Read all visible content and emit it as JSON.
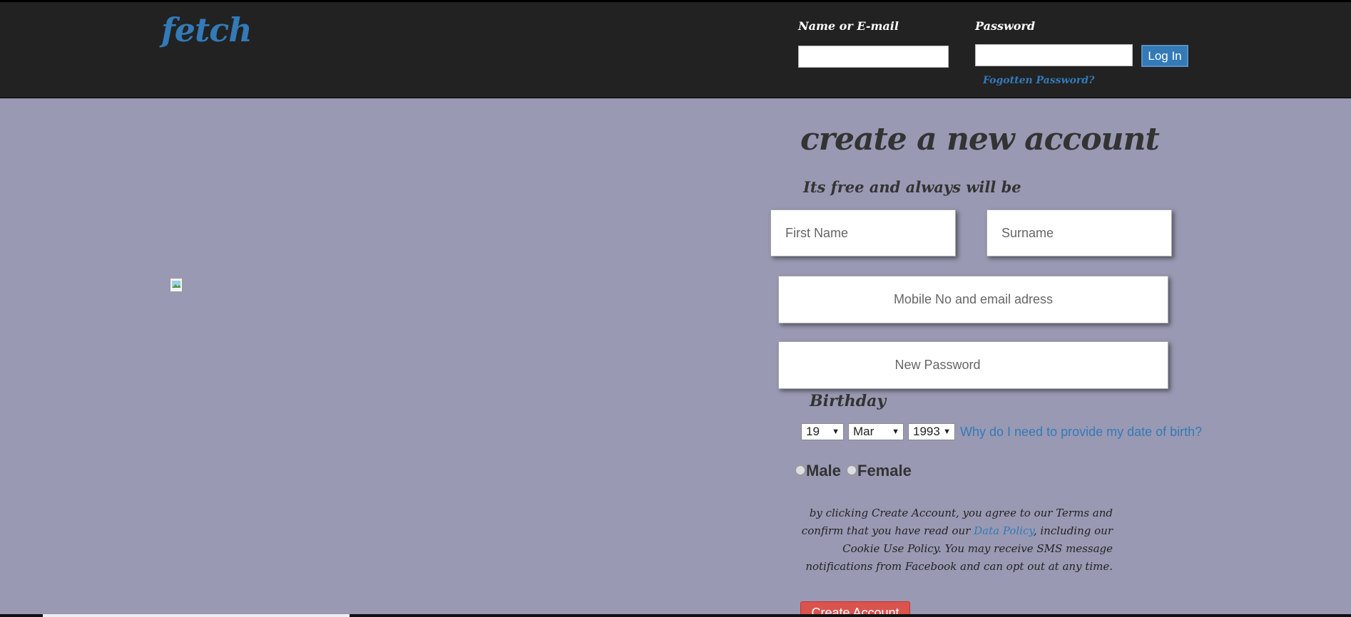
{
  "header": {
    "logo": "fetch",
    "login_label": "Name or E-mail",
    "password_label": "Password",
    "login_button": "Log In",
    "forgot_link": "Fogotten Password?"
  },
  "signup": {
    "title": "create a new account",
    "subtitle": "Its free and always will be",
    "first_name_placeholder": "First Name",
    "surname_placeholder": "Surname",
    "contact_placeholder": "Mobile No and email adress",
    "password_placeholder": "New Password",
    "birthday_label": "Birthday",
    "birthday": {
      "day": "19",
      "month": "Mar",
      "year": "1993"
    },
    "why_link": "Why do I need to provide my date of birth?",
    "male_label": "Male",
    "female_label": "Female",
    "terms_part1": "by clicking Create Account, you agree to our Terms and confirm that you have read our ",
    "terms_link": "Data Policy",
    "terms_part2": ", including our Cookie Use Policy. You may receive SMS message notifications from Facebook and can opt out at any time.",
    "create_button": "Create Account"
  },
  "colors": {
    "header_bg": "#222222",
    "page_bg": "#9999b3",
    "accent": "#337ab7",
    "create_button": "#d9534f"
  }
}
